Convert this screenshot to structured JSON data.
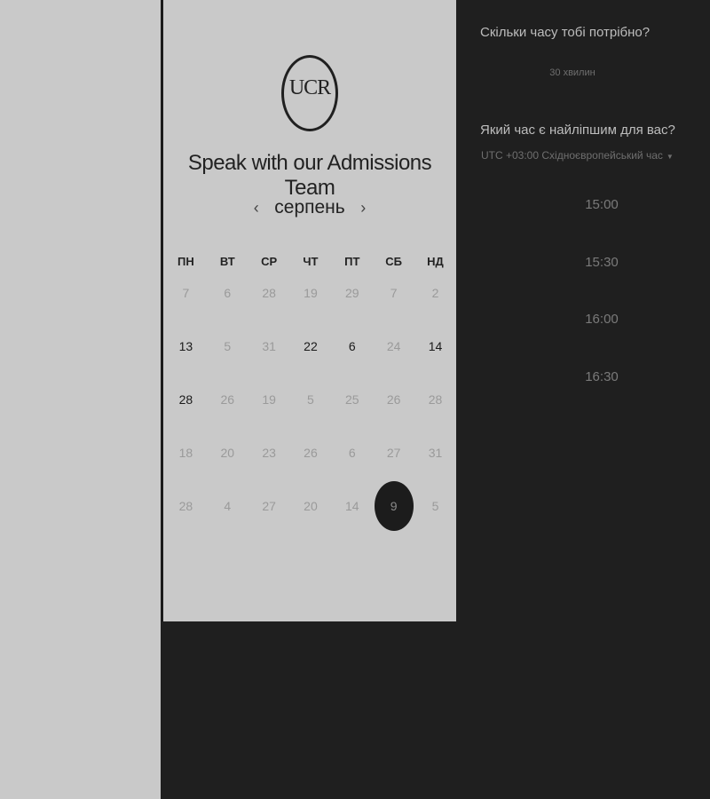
{
  "logo": {
    "text": "UCR"
  },
  "card": {
    "title": "Speak with our Admissions Team",
    "month": "серпень",
    "prev_icon": "‹",
    "next_icon": "›",
    "weekdays": [
      "ПН",
      "ВТ",
      "СР",
      "ЧТ",
      "ПТ",
      "СБ",
      "НД"
    ],
    "weeks": [
      [
        "7",
        "6",
        "28",
        "19",
        "29",
        "7",
        "2"
      ],
      [
        "13",
        "5",
        "31",
        "22",
        "6",
        "24",
        "14"
      ],
      [
        "28",
        "26",
        "19",
        "5",
        "25",
        "26",
        "28"
      ],
      [
        "18",
        "20",
        "23",
        "26",
        "6",
        "27",
        "31"
      ],
      [
        "28",
        "4",
        "27",
        "20",
        "14",
        "9",
        "5"
      ]
    ]
  },
  "scheduler": {
    "duration_question": "Скільки часу тобі потрібно?",
    "duration_value": "30 хвилин",
    "time_question": "Який час є найліпшим для вас?",
    "timezone": "UTC +03:00 Східноєвропейський час",
    "slots": [
      "15:00",
      "15:30",
      "16:00",
      "16:30"
    ]
  }
}
